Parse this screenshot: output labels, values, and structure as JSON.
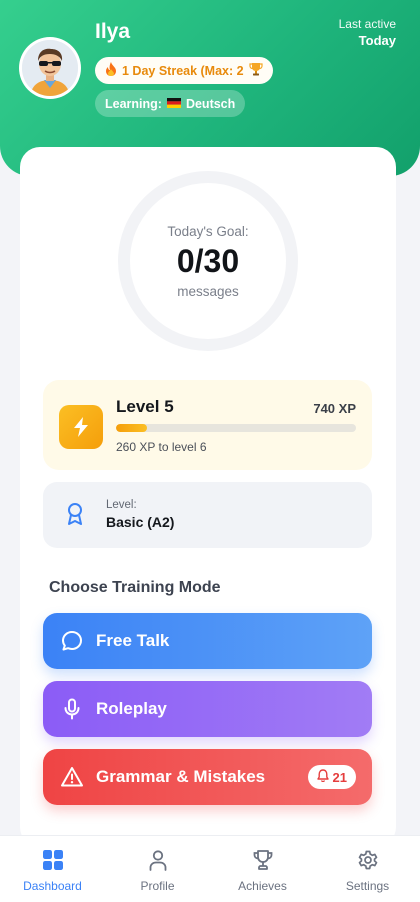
{
  "user": {
    "name": "Ilya",
    "streak_text": "1 Day Streak (Max: 2",
    "learning_label": "Learning:",
    "learning_language": "Deutsch",
    "last_active_label": "Last active",
    "last_active_value": "Today"
  },
  "goal": {
    "label": "Today's Goal:",
    "value": "0/30",
    "unit": "messages",
    "progress": 0
  },
  "level": {
    "title": "Level 5",
    "xp": "740 XP",
    "to_next": "260 XP to level 6",
    "progress_fraction": 0.13
  },
  "proficiency": {
    "label": "Level:",
    "value": "Basic (A2)"
  },
  "training": {
    "title": "Choose Training Mode",
    "modes": [
      {
        "label": "Free Talk",
        "icon": "chat-bubble-icon"
      },
      {
        "label": "Roleplay",
        "icon": "microphone-icon"
      },
      {
        "label": "Grammar & Mistakes",
        "icon": "warning-icon",
        "badge_count": "21"
      }
    ]
  },
  "nav": {
    "items": [
      {
        "label": "Dashboard",
        "icon": "grid-icon",
        "active": true
      },
      {
        "label": "Profile",
        "icon": "user-icon",
        "active": false
      },
      {
        "label": "Achieves",
        "icon": "trophy-icon",
        "active": false
      },
      {
        "label": "Settings",
        "icon": "gear-icon",
        "active": false
      }
    ]
  },
  "colors": {
    "header_green": "#1fb57c",
    "accent_blue": "#3b82f6",
    "accent_purple": "#8b5cf6",
    "accent_red": "#ef4444",
    "accent_amber": "#f59e0b"
  }
}
